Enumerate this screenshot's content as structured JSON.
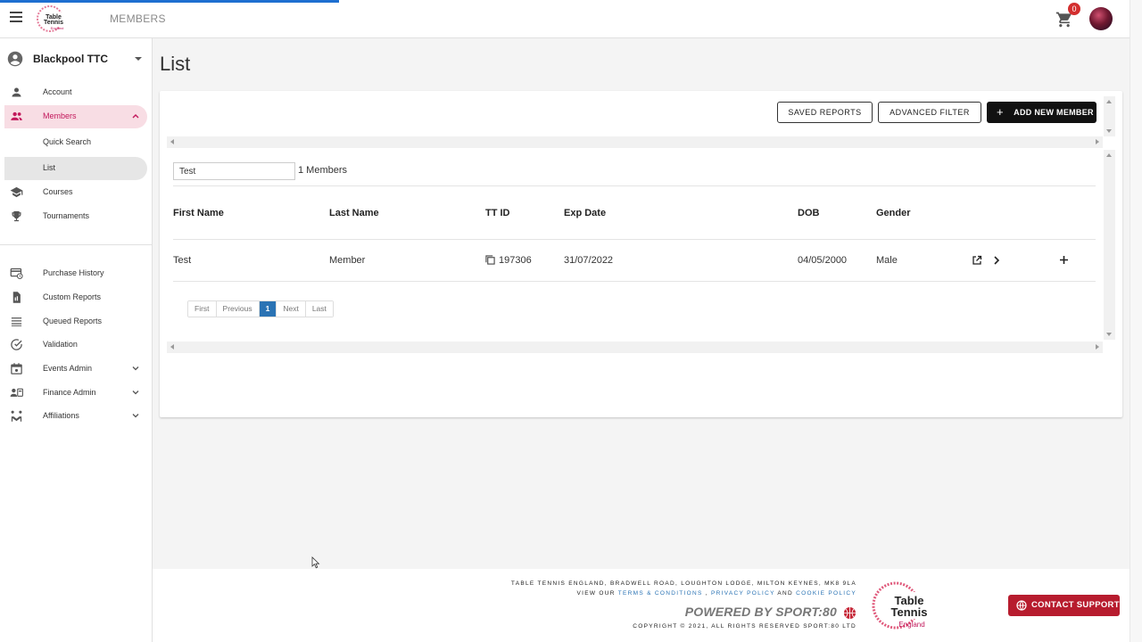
{
  "topbar": {
    "title": "MEMBERS",
    "cart_count": "0"
  },
  "sidebar": {
    "club_name": "Blackpool TTC",
    "items": [
      {
        "label": "Account"
      },
      {
        "label": "Members"
      },
      {
        "label": "Quick Search"
      },
      {
        "label": "List"
      },
      {
        "label": "Courses"
      },
      {
        "label": "Tournaments"
      },
      {
        "label": "Purchase History"
      },
      {
        "label": "Custom Reports"
      },
      {
        "label": "Queued Reports"
      },
      {
        "label": "Validation"
      },
      {
        "label": "Events Admin"
      },
      {
        "label": "Finance Admin"
      },
      {
        "label": "Affiliations"
      }
    ]
  },
  "main": {
    "title": "List",
    "buttons": {
      "saved_reports": "SAVED REPORTS",
      "advanced_filter": "ADVANCED FILTER",
      "add_new_member": "ADD NEW MEMBER"
    },
    "search_value": "Test",
    "member_count": "1 Members",
    "columns": [
      "First Name",
      "Last Name",
      "TT ID",
      "Exp Date",
      "DOB",
      "Gender"
    ],
    "rows": [
      {
        "first_name": "Test",
        "last_name": "Member",
        "tt_id": "197306",
        "exp_date": "31/07/2022",
        "dob": "04/05/2000",
        "gender": "Male"
      }
    ],
    "pager": {
      "first": "First",
      "previous": "Previous",
      "current": "1",
      "next": "Next",
      "last": "Last"
    }
  },
  "footer": {
    "address": "TABLE TENNIS ENGLAND, BRADWELL ROAD, LOUGHTON LODGE, MILTON KEYNES, MK8 9LA",
    "view_our": "VIEW OUR",
    "terms": "TERMS & CONDITIONS",
    "comma": ",",
    "privacy": "PRIVACY POLICY",
    "and": "AND",
    "cookie": "COOKIE POLICY",
    "powered": "POWERED BY SPORT:80",
    "copyright": "COPYRIGHT © 2021, ALL RIGHTS RESERVED SPORT:80 LTD",
    "logo_text_1": "Table",
    "logo_text_2": "Tennis",
    "logo_text_3": "England"
  },
  "contact_support": "CONTACT SUPPORT",
  "colors": {
    "accent_pink": "#c2185b",
    "active_bg": "#f8dde4",
    "pager_blue": "#2a73b4",
    "contact_red": "#b71c2e",
    "progress_blue": "#1e6fd0"
  }
}
